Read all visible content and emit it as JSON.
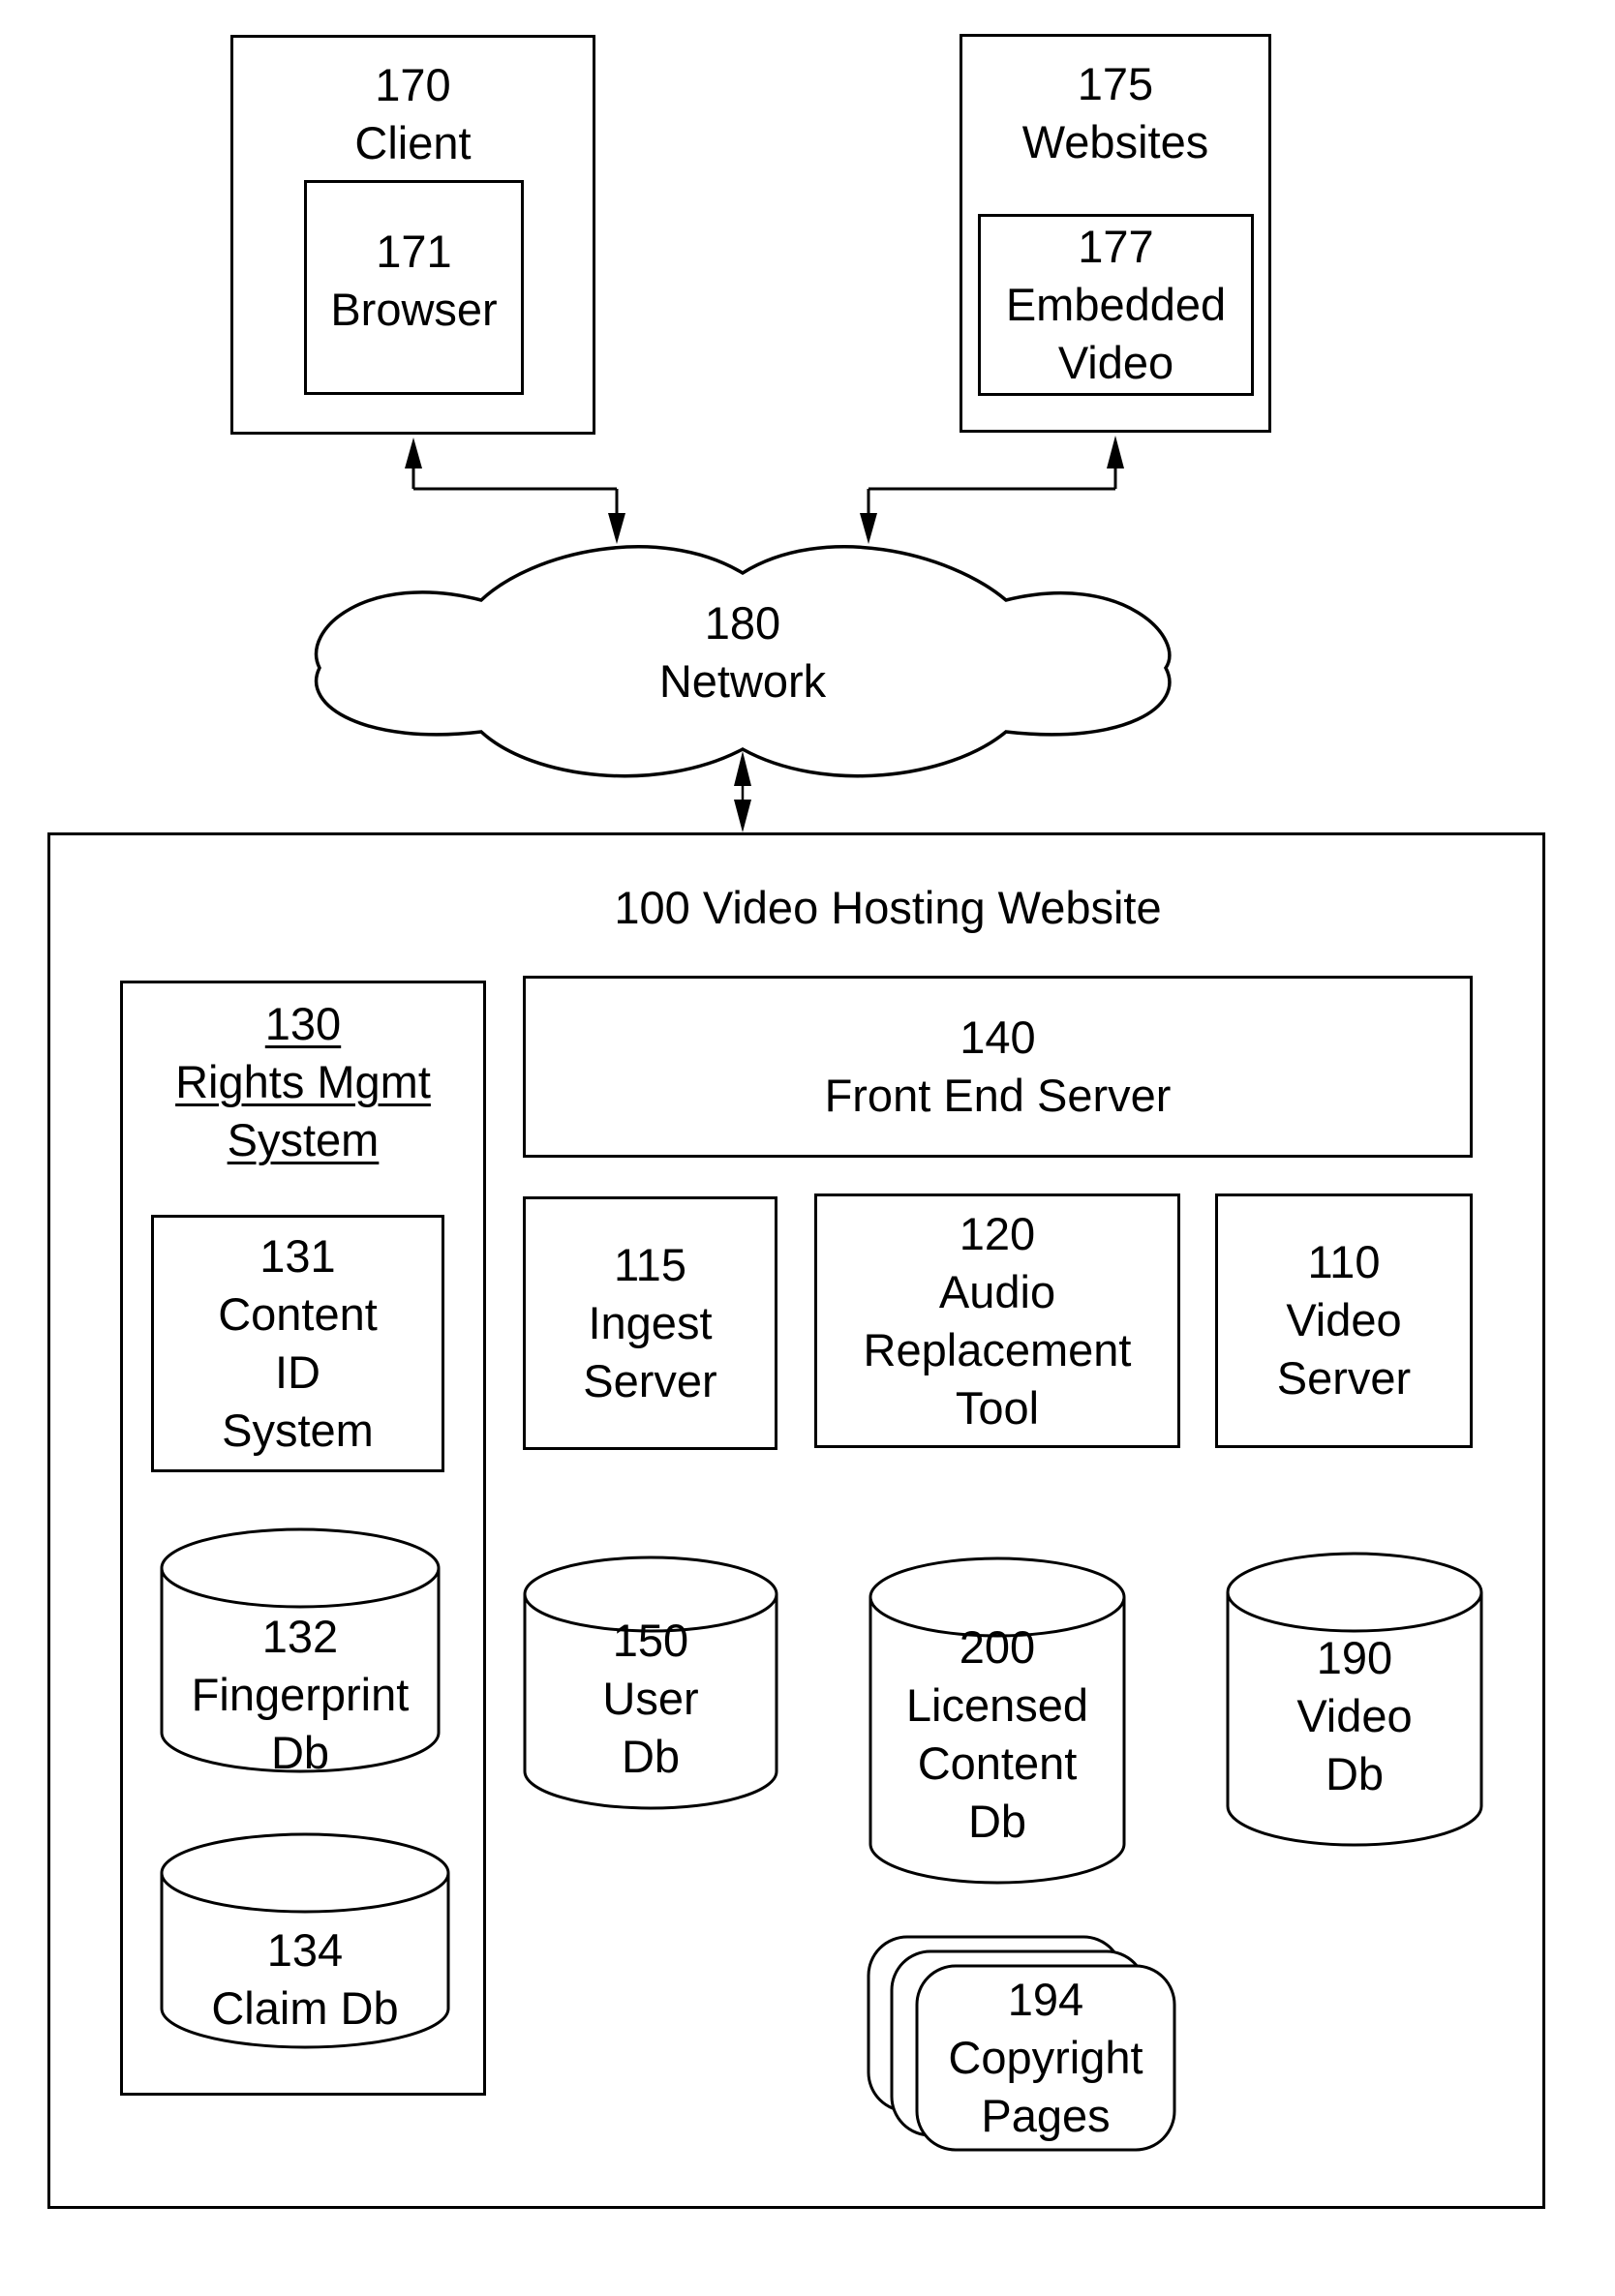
{
  "diagram": {
    "type": "system-architecture",
    "colors": {
      "stroke": "#000000",
      "background": "#ffffff"
    },
    "external": {
      "client": {
        "id": "170",
        "name": "Client",
        "browser": {
          "id": "171",
          "name": "Browser"
        }
      },
      "websites": {
        "id": "175",
        "name": "Websites",
        "embedded_video": {
          "id": "177",
          "line1": "Embedded",
          "line2": "Video"
        }
      },
      "network": {
        "id": "180",
        "name": "Network"
      }
    },
    "hosting": {
      "title": "100 Video Hosting Website",
      "rights_mgmt": {
        "id": "130",
        "line1": "Rights Mgmt",
        "line2": "System",
        "content_id": {
          "id": "131",
          "line1": "Content",
          "line2": "ID",
          "line3": "System"
        },
        "fingerprint_db": {
          "id": "132",
          "line1": "Fingerprint",
          "line2": "Db"
        },
        "claim_db": {
          "id": "134",
          "line1": "Claim Db"
        }
      },
      "front_end": {
        "id": "140",
        "name": "Front End Server"
      },
      "ingest": {
        "id": "115",
        "line1": "Ingest",
        "line2": "Server"
      },
      "audio_tool": {
        "id": "120",
        "line1": "Audio",
        "line2": "Replacement",
        "line3": "Tool"
      },
      "video_server": {
        "id": "110",
        "line1": "Video",
        "line2": "Server"
      },
      "user_db": {
        "id": "150",
        "line1": "User",
        "line2": "Db"
      },
      "licensed_db": {
        "id": "200",
        "line1": "Licensed",
        "line2": "Content",
        "line3": "Db"
      },
      "video_db": {
        "id": "190",
        "line1": "Video",
        "line2": "Db"
      },
      "copyright_pages": {
        "id": "194",
        "line1": "Copyright",
        "line2": "Pages"
      }
    },
    "connections": [
      {
        "from": "170",
        "to": "180",
        "bidirectional": true
      },
      {
        "from": "175",
        "to": "180",
        "bidirectional": true
      },
      {
        "from": "180",
        "to": "100",
        "bidirectional": true
      }
    ]
  }
}
